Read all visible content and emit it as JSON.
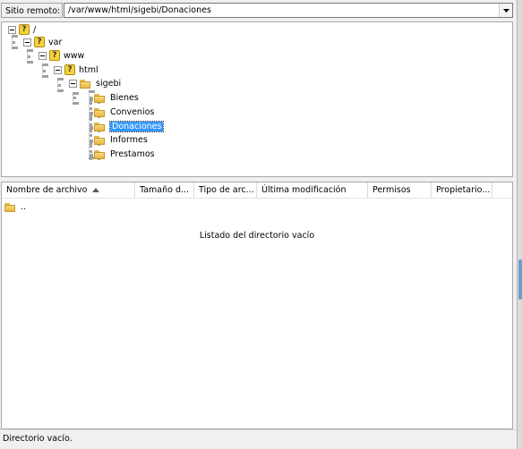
{
  "remote": {
    "label": "Sitio remoto:",
    "path": "/var/www/html/sigebi/Donaciones"
  },
  "tree": {
    "items": [
      {
        "label": "/",
        "icon": "question-icon",
        "expanded": true
      },
      {
        "label": "var",
        "icon": "question-icon",
        "expanded": true
      },
      {
        "label": "www",
        "icon": "question-icon",
        "expanded": true
      },
      {
        "label": "html",
        "icon": "question-icon",
        "expanded": true
      },
      {
        "label": "sigebi",
        "icon": "folder-icon",
        "expanded": true
      },
      {
        "label": "Bienes",
        "icon": "folder-icon"
      },
      {
        "label": "Convenios",
        "icon": "folder-icon"
      },
      {
        "label": "Donaciones",
        "icon": "folder-icon",
        "selected": true
      },
      {
        "label": "Informes",
        "icon": "folder-icon"
      },
      {
        "label": "Prestamos",
        "icon": "folder-icon"
      }
    ]
  },
  "file_list": {
    "columns": [
      "Nombre de archivo",
      "Tamaño d...",
      "Tipo de arc...",
      "Última modificación",
      "Permisos",
      "Propietario..."
    ],
    "sort_column": "Nombre de archivo",
    "sort_direction": "ascending",
    "rows": [
      {
        "name": ".."
      }
    ],
    "empty_message": "Listado del directorio vacío"
  },
  "status": {
    "text": "Directorio vacío."
  },
  "colors": {
    "selection": "#3399ff",
    "folder": "#f2c85a",
    "question_icon": "#f5d23c"
  }
}
